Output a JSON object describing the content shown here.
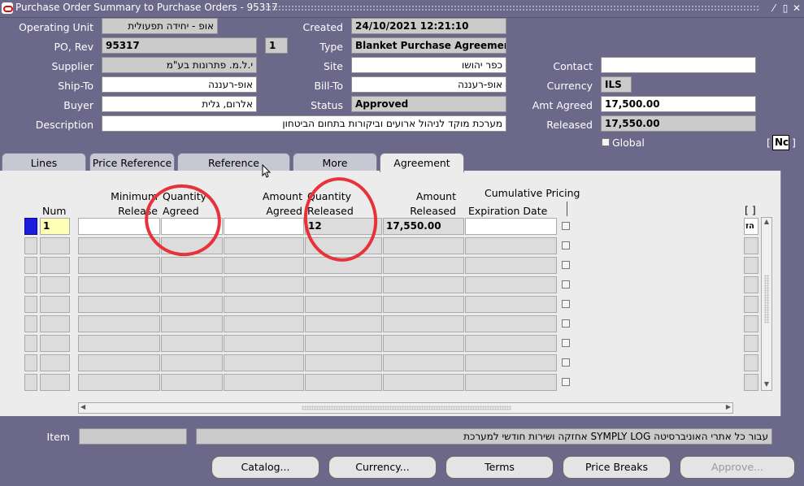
{
  "window": {
    "title": "Purchase Order Summary to Purchase Orders - 95317",
    "icon": "oracle-icon"
  },
  "header": {
    "operating_unit_label": "Operating Unit",
    "operating_unit": "אופ - יחידה תפעולית",
    "po_rev_label": "PO, Rev",
    "po_number": "95317",
    "revision": "1",
    "supplier_label": "Supplier",
    "supplier": "י.ל.מ. פתרונות בע\"מ",
    "ship_to_label": "Ship-To",
    "ship_to": "אופ-רעננה",
    "buyer_label": "Buyer",
    "buyer": "אלרום, גלית",
    "description_label": "Description",
    "description": "מערכת מוקד לניהול ארועים וביקורות בתחום הביטחון",
    "created_label": "Created",
    "created": "24/10/2021 12:21:10",
    "type_label": "Type",
    "type": "Blanket Purchase Agreement",
    "site_label": "Site",
    "site": "כפר יהושו",
    "bill_to_label": "Bill-To",
    "bill_to": "אופ-רעננה",
    "status_label": "Status",
    "status": "Approved",
    "contact_label": "Contact",
    "contact": "",
    "currency_label": "Currency",
    "currency": "ILS",
    "amt_agreed_label": "Amt Agreed",
    "amt_agreed": "17,500.00",
    "released_label": "Released",
    "released": "17,550.00",
    "global_label": "Global",
    "global_checked": false,
    "bracket_value": "Nc"
  },
  "tabs": [
    {
      "label": "Lines"
    },
    {
      "label": "Price Reference"
    },
    {
      "label": "Reference Documents"
    },
    {
      "label": "More"
    },
    {
      "label": "Agreement",
      "active": true
    }
  ],
  "columns": {
    "num": "Num",
    "min_release_1": "Minimum",
    "min_release_2": "Release",
    "qty_agreed_1": "Quantity",
    "qty_agreed_2": "Agreed",
    "amount_agreed_1": "Amount",
    "amount_agreed_2": "Agreed",
    "qty_released_1": "Quantity",
    "qty_released_2": "Released",
    "amount_released_1": "Amount",
    "amount_released_2": "Released",
    "cumulative_pricing": "Cumulative Pricing",
    "expiration_date": "Expiration Date",
    "folder": "[ ]"
  },
  "rows": [
    {
      "num": "1",
      "min_release": "",
      "qty_agreed": "",
      "amount_agreed": "",
      "qty_released": "12",
      "amount_released": "17,550.00",
      "expiration_date": "",
      "right": "הז"
    }
  ],
  "item": {
    "label": "Item",
    "value": "",
    "description": "עבור כל אתרי האוניברסיטה SYMPLY LOG אחזקה ושירות חודשי למערכת"
  },
  "buttons": {
    "catalog": "Catalog...",
    "currency": "Currency...",
    "terms": "Terms",
    "price_breaks": "Price Breaks",
    "approve": "Approve..."
  },
  "annotation_color": "#e8323a"
}
